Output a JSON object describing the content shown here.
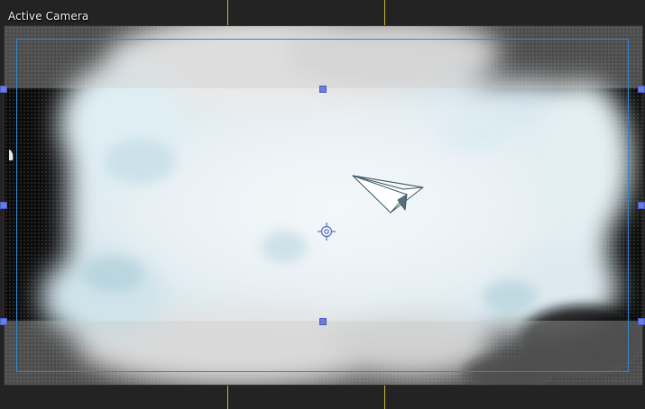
{
  "viewport": {
    "title": "Active Camera"
  },
  "icons": {
    "subject": "paper-plane-icon",
    "anchor": "anchor-point-icon"
  },
  "colors": {
    "background": "#232323",
    "camera_frame": "#2f86d6",
    "handle": "#6b7fd8",
    "guide": "#c9b83a"
  }
}
